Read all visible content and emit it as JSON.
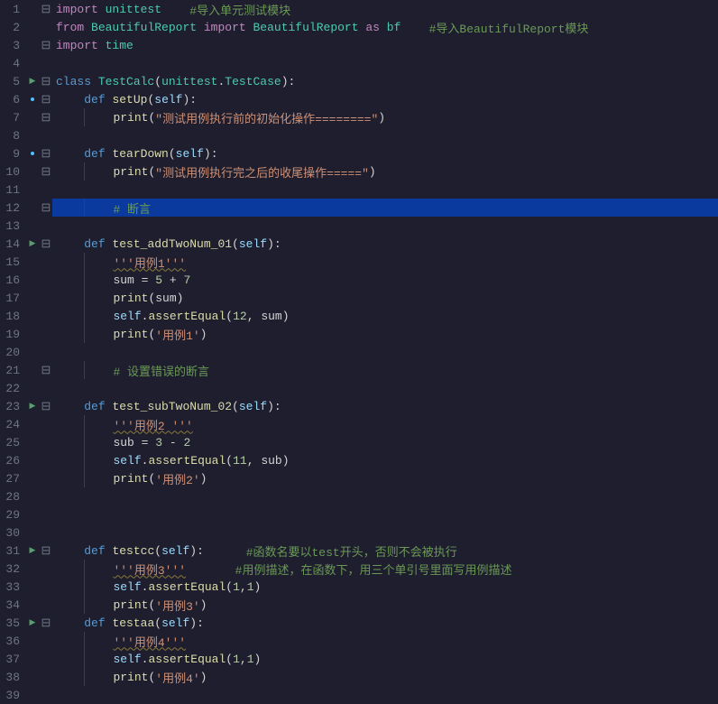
{
  "lines": [
    {
      "n": 1,
      "marker": "",
      "fold": "-",
      "indent": 0,
      "hl": false,
      "segs": [
        [
          "kw2",
          "import"
        ],
        [
          "op",
          " "
        ],
        [
          "cls",
          "unittest"
        ],
        [
          "op",
          "    "
        ],
        [
          "cm",
          "#导入单元测试模块"
        ]
      ]
    },
    {
      "n": 2,
      "marker": "",
      "fold": "",
      "indent": 0,
      "hl": false,
      "segs": [
        [
          "kw2",
          "from"
        ],
        [
          "op",
          " "
        ],
        [
          "cls",
          "BeautifulReport"
        ],
        [
          "op",
          " "
        ],
        [
          "kw2",
          "import"
        ],
        [
          "op",
          " "
        ],
        [
          "cls",
          "BeautifulReport"
        ],
        [
          "op",
          " "
        ],
        [
          "kw2",
          "as"
        ],
        [
          "op",
          " "
        ],
        [
          "cls",
          "bf"
        ],
        [
          "op",
          "    "
        ],
        [
          "cm",
          "#导入BeautifulReport模块"
        ]
      ]
    },
    {
      "n": 3,
      "marker": "",
      "fold": "-",
      "indent": 0,
      "hl": false,
      "segs": [
        [
          "kw2",
          "import"
        ],
        [
          "op",
          " "
        ],
        [
          "cls",
          "time"
        ]
      ]
    },
    {
      "n": 4,
      "marker": "",
      "fold": "",
      "indent": 0,
      "hl": false,
      "segs": []
    },
    {
      "n": 5,
      "marker": "tri",
      "fold": "-",
      "indent": 0,
      "hl": false,
      "segs": [
        [
          "kw",
          "class"
        ],
        [
          "op",
          " "
        ],
        [
          "cls",
          "TestCalc"
        ],
        [
          "op",
          "("
        ],
        [
          "cls",
          "unittest"
        ],
        [
          "op",
          "."
        ],
        [
          "cls",
          "TestCase"
        ],
        [
          "op",
          "):"
        ]
      ]
    },
    {
      "n": 6,
      "marker": "bp",
      "fold": "-",
      "indent": 1,
      "hl": false,
      "segs": [
        [
          "kw",
          "def"
        ],
        [
          "op",
          " "
        ],
        [
          "fn",
          "setUp"
        ],
        [
          "op",
          "("
        ],
        [
          "self",
          "self"
        ],
        [
          "op",
          "):"
        ]
      ]
    },
    {
      "n": 7,
      "marker": "",
      "fold": "-",
      "indent": 2,
      "hl": false,
      "segs": [
        [
          "fn",
          "print"
        ],
        [
          "op",
          "("
        ],
        [
          "str",
          "\"测试用例执行前的初始化操作========\""
        ],
        [
          "op",
          ")"
        ]
      ]
    },
    {
      "n": 8,
      "marker": "",
      "fold": "",
      "indent": 0,
      "hl": false,
      "segs": []
    },
    {
      "n": 9,
      "marker": "bp",
      "fold": "-",
      "indent": 1,
      "hl": false,
      "segs": [
        [
          "kw",
          "def"
        ],
        [
          "op",
          " "
        ],
        [
          "fn",
          "tearDown"
        ],
        [
          "op",
          "("
        ],
        [
          "self",
          "self"
        ],
        [
          "op",
          "):"
        ]
      ]
    },
    {
      "n": 10,
      "marker": "",
      "fold": "-",
      "indent": 2,
      "hl": false,
      "segs": [
        [
          "fn",
          "print"
        ],
        [
          "op",
          "("
        ],
        [
          "str",
          "\"测试用例执行完之后的收尾操作=====\""
        ],
        [
          "op",
          ")"
        ]
      ]
    },
    {
      "n": 11,
      "marker": "",
      "fold": "",
      "indent": 0,
      "hl": false,
      "segs": []
    },
    {
      "n": 12,
      "marker": "",
      "fold": "-",
      "indent": 2,
      "hl": true,
      "segs": [
        [
          "cm",
          "# 断言"
        ]
      ],
      "caret": true
    },
    {
      "n": 13,
      "marker": "",
      "fold": "",
      "indent": 0,
      "hl": false,
      "segs": []
    },
    {
      "n": 14,
      "marker": "tri",
      "fold": "-",
      "indent": 1,
      "hl": false,
      "segs": [
        [
          "kw",
          "def"
        ],
        [
          "op",
          " "
        ],
        [
          "fn",
          "test_addTwoNum_01"
        ],
        [
          "op",
          "("
        ],
        [
          "self",
          "self"
        ],
        [
          "op",
          "):"
        ]
      ]
    },
    {
      "n": 15,
      "marker": "",
      "fold": "",
      "indent": 2,
      "hl": false,
      "segs": [
        [
          "str-u",
          "'''用例1'''"
        ]
      ]
    },
    {
      "n": 16,
      "marker": "",
      "fold": "",
      "indent": 2,
      "hl": false,
      "segs": [
        [
          "op",
          "sum = "
        ],
        [
          "num",
          "5"
        ],
        [
          "op",
          " + "
        ],
        [
          "num",
          "7"
        ]
      ]
    },
    {
      "n": 17,
      "marker": "",
      "fold": "",
      "indent": 2,
      "hl": false,
      "segs": [
        [
          "fn",
          "print"
        ],
        [
          "op",
          "(sum)"
        ]
      ]
    },
    {
      "n": 18,
      "marker": "",
      "fold": "",
      "indent": 2,
      "hl": false,
      "segs": [
        [
          "self",
          "self"
        ],
        [
          "op",
          "."
        ],
        [
          "fn",
          "assertEqual"
        ],
        [
          "op",
          "("
        ],
        [
          "num",
          "12"
        ],
        [
          "op",
          ", sum)"
        ]
      ]
    },
    {
      "n": 19,
      "marker": "",
      "fold": "",
      "indent": 2,
      "hl": false,
      "segs": [
        [
          "fn",
          "print"
        ],
        [
          "op",
          "("
        ],
        [
          "str",
          "'用例1'"
        ],
        [
          "op",
          ")"
        ]
      ]
    },
    {
      "n": 20,
      "marker": "",
      "fold": "",
      "indent": 0,
      "hl": false,
      "segs": []
    },
    {
      "n": 21,
      "marker": "",
      "fold": "-",
      "indent": 2,
      "hl": false,
      "segs": [
        [
          "cm",
          "# 设置错误的断言"
        ]
      ]
    },
    {
      "n": 22,
      "marker": "",
      "fold": "",
      "indent": 0,
      "hl": false,
      "segs": []
    },
    {
      "n": 23,
      "marker": "tri",
      "fold": "-",
      "indent": 1,
      "hl": false,
      "segs": [
        [
          "kw",
          "def"
        ],
        [
          "op",
          " "
        ],
        [
          "fn",
          "test_subTwoNum_02"
        ],
        [
          "op",
          "("
        ],
        [
          "self",
          "self"
        ],
        [
          "op",
          "):"
        ]
      ]
    },
    {
      "n": 24,
      "marker": "",
      "fold": "",
      "indent": 2,
      "hl": false,
      "segs": [
        [
          "str-u",
          "'''用例2 '''"
        ]
      ]
    },
    {
      "n": 25,
      "marker": "",
      "fold": "",
      "indent": 2,
      "hl": false,
      "segs": [
        [
          "op",
          "sub = "
        ],
        [
          "num",
          "3"
        ],
        [
          "op",
          " - "
        ],
        [
          "num",
          "2"
        ]
      ]
    },
    {
      "n": 26,
      "marker": "",
      "fold": "",
      "indent": 2,
      "hl": false,
      "segs": [
        [
          "self",
          "self"
        ],
        [
          "op",
          "."
        ],
        [
          "fn",
          "assertEqual"
        ],
        [
          "op",
          "("
        ],
        [
          "num",
          "11"
        ],
        [
          "op",
          ", sub)"
        ]
      ]
    },
    {
      "n": 27,
      "marker": "",
      "fold": "",
      "indent": 2,
      "hl": false,
      "segs": [
        [
          "fn",
          "print"
        ],
        [
          "op",
          "("
        ],
        [
          "str",
          "'用例2'"
        ],
        [
          "op",
          ")"
        ]
      ]
    },
    {
      "n": 28,
      "marker": "",
      "fold": "",
      "indent": 0,
      "hl": false,
      "segs": []
    },
    {
      "n": 29,
      "marker": "",
      "fold": "",
      "indent": 0,
      "hl": false,
      "segs": []
    },
    {
      "n": 30,
      "marker": "",
      "fold": "",
      "indent": 0,
      "hl": false,
      "segs": []
    },
    {
      "n": 31,
      "marker": "tri",
      "fold": "-",
      "indent": 1,
      "hl": false,
      "segs": [
        [
          "kw",
          "def"
        ],
        [
          "op",
          " "
        ],
        [
          "fn",
          "testcc"
        ],
        [
          "op",
          "("
        ],
        [
          "self",
          "self"
        ],
        [
          "op",
          "):      "
        ],
        [
          "cm",
          "#函数名要以test开头，否则不会被执行"
        ]
      ]
    },
    {
      "n": 32,
      "marker": "",
      "fold": "",
      "indent": 2,
      "hl": false,
      "segs": [
        [
          "str-u",
          "'''用例3'''"
        ],
        [
          "op",
          "       "
        ],
        [
          "cm",
          "#用例描述，在函数下，用三个单引号里面写用例描述"
        ]
      ]
    },
    {
      "n": 33,
      "marker": "",
      "fold": "",
      "indent": 2,
      "hl": false,
      "segs": [
        [
          "self",
          "self"
        ],
        [
          "op",
          "."
        ],
        [
          "fn",
          "assertEqual"
        ],
        [
          "op",
          "("
        ],
        [
          "num",
          "1"
        ],
        [
          "op",
          ","
        ],
        [
          "num",
          "1"
        ],
        [
          "op",
          ")"
        ]
      ]
    },
    {
      "n": 34,
      "marker": "",
      "fold": "",
      "indent": 2,
      "hl": false,
      "segs": [
        [
          "fn",
          "print"
        ],
        [
          "op",
          "("
        ],
        [
          "str",
          "'用例3'"
        ],
        [
          "op",
          ")"
        ]
      ]
    },
    {
      "n": 35,
      "marker": "tri",
      "fold": "-",
      "indent": 1,
      "hl": false,
      "segs": [
        [
          "kw",
          "def"
        ],
        [
          "op",
          " "
        ],
        [
          "fn",
          "testaa"
        ],
        [
          "op",
          "("
        ],
        [
          "self",
          "self"
        ],
        [
          "op",
          "):"
        ]
      ]
    },
    {
      "n": 36,
      "marker": "",
      "fold": "",
      "indent": 2,
      "hl": false,
      "segs": [
        [
          "str-u",
          "'''用例4'''"
        ]
      ]
    },
    {
      "n": 37,
      "marker": "",
      "fold": "",
      "indent": 2,
      "hl": false,
      "segs": [
        [
          "self",
          "self"
        ],
        [
          "op",
          "."
        ],
        [
          "fn",
          "assertEqual"
        ],
        [
          "op",
          "("
        ],
        [
          "num",
          "1"
        ],
        [
          "op",
          ","
        ],
        [
          "num",
          "1"
        ],
        [
          "op",
          ")"
        ]
      ]
    },
    {
      "n": 38,
      "marker": "",
      "fold": "",
      "indent": 2,
      "hl": false,
      "segs": [
        [
          "fn",
          "print"
        ],
        [
          "op",
          "("
        ],
        [
          "str",
          "'用例4'"
        ],
        [
          "op",
          ")"
        ]
      ]
    },
    {
      "n": 39,
      "marker": "",
      "fold": "",
      "indent": 0,
      "hl": false,
      "segs": []
    }
  ]
}
